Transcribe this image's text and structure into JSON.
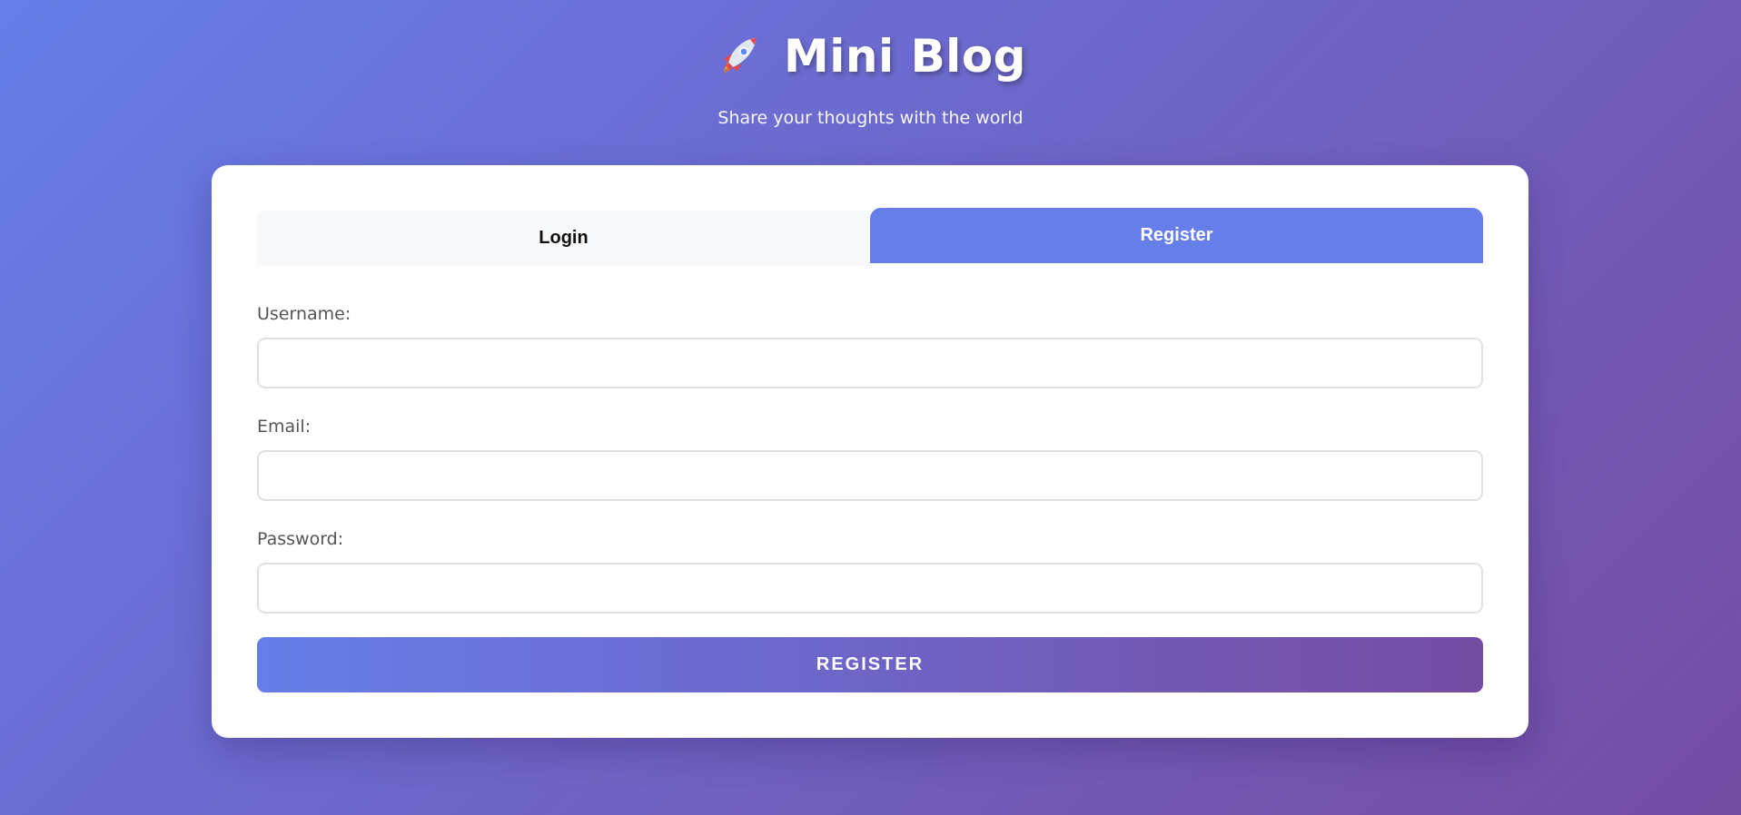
{
  "app": {
    "title": "Mini Blog",
    "subtitle": "Share your thoughts with the world",
    "logo_icon": "rocket-icon"
  },
  "tabs": {
    "login_label": "Login",
    "register_label": "Register",
    "active": "Register"
  },
  "form": {
    "username_label": "Username:",
    "username_value": "",
    "email_label": "Email:",
    "email_value": "",
    "password_label": "Password:",
    "password_value": "",
    "submit_label": "REGISTER"
  },
  "colors": {
    "accent": "#667eea",
    "gradient_start": "#667eea",
    "gradient_end": "#764ba2"
  }
}
